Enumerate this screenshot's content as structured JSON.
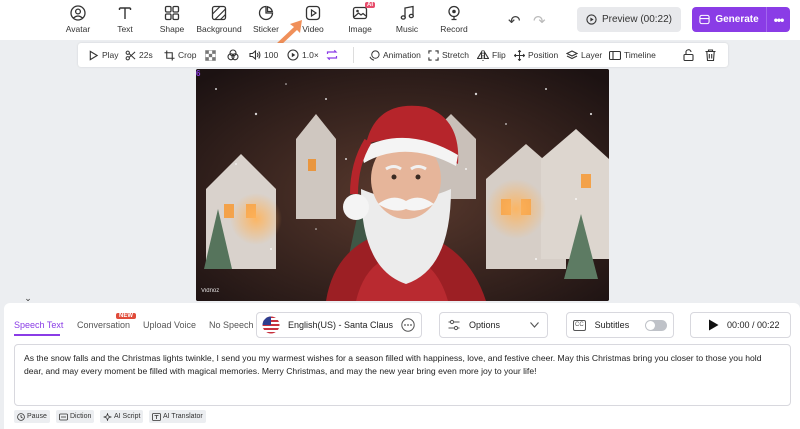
{
  "toolbar": {
    "tools": [
      {
        "label": "Avatar",
        "icon": "avatar-icon"
      },
      {
        "label": "Text",
        "icon": "text-icon"
      },
      {
        "label": "Shape",
        "icon": "shape-icon"
      },
      {
        "label": "Background",
        "icon": "background-icon"
      },
      {
        "label": "Sticker",
        "icon": "sticker-icon"
      },
      {
        "label": "Video",
        "icon": "video-icon"
      },
      {
        "label": "Image",
        "icon": "image-icon",
        "badge": "AI"
      },
      {
        "label": "Music",
        "icon": "music-icon"
      },
      {
        "label": "Record",
        "icon": "record-icon"
      }
    ],
    "preview_label": "Preview (00:22)",
    "generate_label": "Generate",
    "more_label": "•••"
  },
  "edit_toolbar": {
    "play": "Play",
    "duration": "22s",
    "crop": "Crop",
    "volume": "100",
    "speed": "1.0×",
    "animation": "Animation",
    "stretch": "Stretch",
    "flip": "Flip",
    "position": "Position",
    "layer": "Layer",
    "timeline": "Timeline"
  },
  "canvas": {
    "corner_label": "6",
    "watermark": "Vidnoz"
  },
  "speech_panel": {
    "tabs": [
      "Speech Text",
      "Conversation",
      "Upload Voice",
      "No Speech"
    ],
    "active_tab": "Speech Text",
    "new_badge": "NEW",
    "voice": "English(US) - Santa Claus",
    "options_label": "Options",
    "subtitles_label": "Subtitles",
    "subtitles_icon_text": "CC",
    "time_display": "00:00 / 00:22",
    "speech_text": "As the snow falls and the Christmas lights twinkle, I send you my warmest wishes for a season filled with happiness, love, and festive cheer. May this Christmas bring you closer to those you hold dear, and may every moment be filled with magical memories. Merry Christmas, and may the new year bring even more joy to your life!",
    "chips": [
      "Pause",
      "Diction",
      "AI Script",
      "AI Translator"
    ]
  },
  "colors": {
    "accent": "#8a3ce6",
    "new_badge": "#e04b3a",
    "ai_badge": "#e74c6b"
  }
}
